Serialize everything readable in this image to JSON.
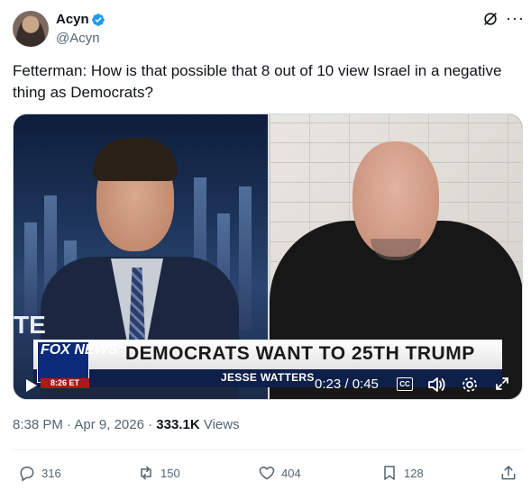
{
  "author": {
    "name": "Acyn",
    "handle": "@Acyn"
  },
  "tweet": {
    "text": "Fetterman: How is that possible that 8 out of 10 view Israel in a negative thing as Democrats?"
  },
  "video": {
    "chyron": "DEMOCRATS WANT TO 25TH TRUMP",
    "chyron_sub": "JESSE WATTERS",
    "network_logo": "FOX NEWS",
    "network_time": "8:26 ET",
    "screen_fragment": "TE",
    "timecode": "0:23 / 0:45",
    "cc_label": "CC"
  },
  "meta": {
    "time": "8:38 PM",
    "date": "Apr 9, 2026",
    "views_count": "333.1K",
    "views_label": "Views"
  },
  "actions": {
    "replies": "316",
    "reposts": "150",
    "likes": "404",
    "bookmarks": "128"
  },
  "colors": {
    "verified": "#1d9bf0",
    "muted_text": "#536471",
    "text": "#0f1419"
  }
}
